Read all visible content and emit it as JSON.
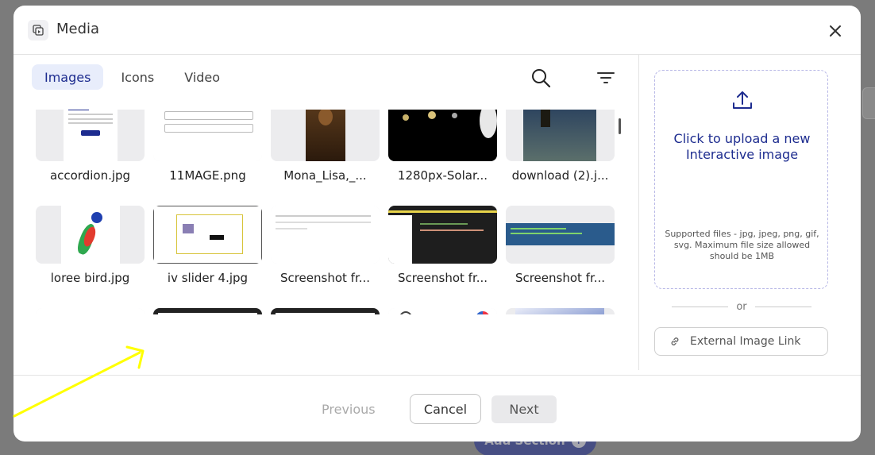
{
  "modal": {
    "title": "Media",
    "tabs": [
      {
        "label": "Images",
        "active": true
      },
      {
        "label": "Icons",
        "active": false
      },
      {
        "label": "Video",
        "active": false
      }
    ]
  },
  "media_items": [
    {
      "name": "accordion.jpg",
      "thumb": "document-thumbnail"
    },
    {
      "name": "11MAGE.png",
      "thumb": "form-thumbnail"
    },
    {
      "name": "Mona_Lisa,_...",
      "thumb": "painting-thumbnail"
    },
    {
      "name": "1280px-Solar...",
      "thumb": "solar-system-thumbnail"
    },
    {
      "name": "download (2).j...",
      "thumb": "starry-night-thumbnail"
    },
    {
      "name": "loree bird.jpg",
      "thumb": "parrot-thumbnail"
    },
    {
      "name": "iv slider 4.jpg",
      "thumb": "slider-screenshot-thumbnail"
    },
    {
      "name": "Screenshot fr...",
      "thumb": "screenshot-thumbnail"
    },
    {
      "name": "Screenshot fr...",
      "thumb": "code-screenshot-thumbnail"
    },
    {
      "name": "Screenshot fr...",
      "thumb": "terminal-screenshot-thumbnail"
    },
    {
      "name": "",
      "thumb": "table-thumbnail"
    },
    {
      "name": "",
      "thumb": "app-screenshot-thumbnail"
    },
    {
      "name": "",
      "thumb": "app-screenshot-thumbnail"
    },
    {
      "name": "",
      "thumb": "kid-illustration-thumbnail"
    },
    {
      "name": "",
      "thumb": "keyboard-thumbnail"
    }
  ],
  "upload": {
    "title": "Click to upload a new Interactive image",
    "note": "Supported files - jpg, jpeg, png, gif, svg. Maximum file size allowed should be 1MB",
    "or_text": "or",
    "external_link_label": "External Image Link"
  },
  "footer": {
    "previous_label": "Previous",
    "cancel_label": "Cancel",
    "next_label": "Next"
  },
  "background": {
    "add_section_label": "Add Section"
  },
  "colors": {
    "accent": "#1d2c8f",
    "active_tab_bg": "#e8edfb",
    "annotation": "#ffff00"
  }
}
